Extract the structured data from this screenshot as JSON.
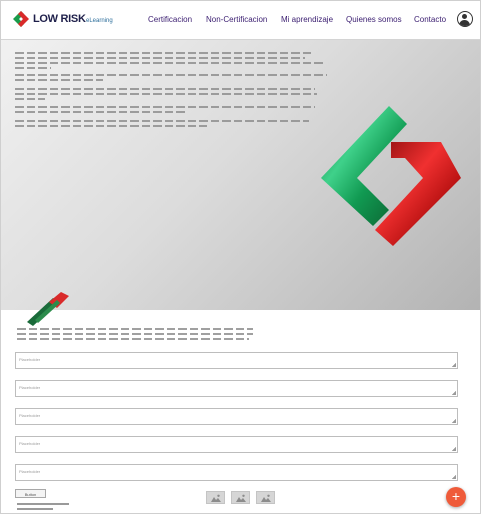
{
  "brand": {
    "name": "LOW RISK",
    "sub": "eLearning",
    "colors": {
      "green": "#1a9b4b",
      "red": "#d92a2a",
      "navy": "#1e1f4a",
      "nav_text": "#3a1d70",
      "fab": "#ef5b3a"
    }
  },
  "nav": {
    "items": [
      {
        "label": "Certificacion"
      },
      {
        "label": "Non-Certificacion"
      },
      {
        "label": "Mi aprendizaje"
      },
      {
        "label": "Quienes somos"
      },
      {
        "label": "Contacto"
      }
    ]
  },
  "header": {
    "avatar_icon": "user-icon"
  },
  "form": {
    "fields": [
      {
        "placeholder": "Placeholder"
      },
      {
        "placeholder": "Placeholder"
      },
      {
        "placeholder": "Placeholder"
      },
      {
        "placeholder": "Placeholder"
      },
      {
        "placeholder": "Placeholder"
      }
    ],
    "submit_label": "Button",
    "image_buttons": [
      "image-icon",
      "image-icon",
      "image-icon"
    ],
    "fab_label": "+"
  }
}
